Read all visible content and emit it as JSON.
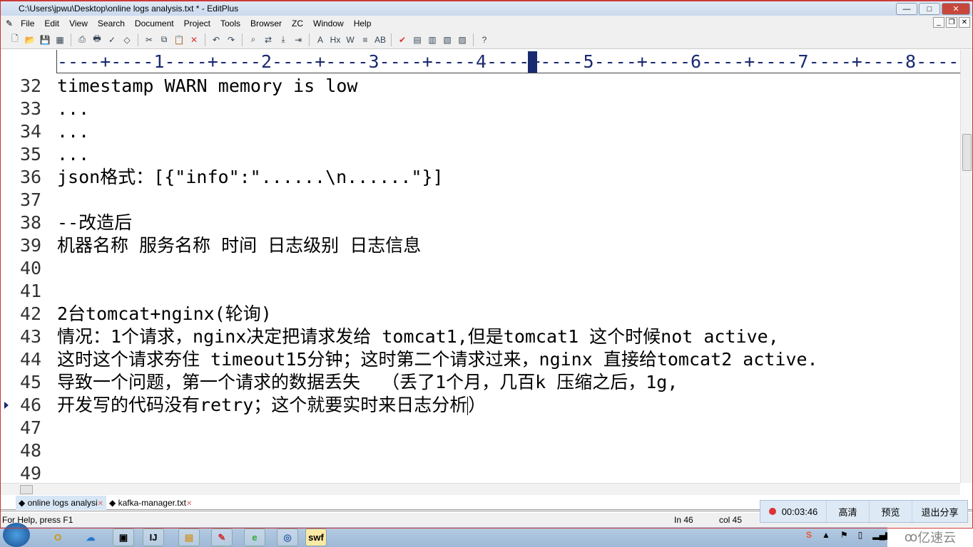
{
  "window": {
    "title": "C:\\Users\\jpwu\\Desktop\\online logs analysis.txt * - EditPlus",
    "minimize": "—",
    "maximize": "□",
    "close": "✕"
  },
  "menu": [
    "File",
    "Edit",
    "View",
    "Search",
    "Document",
    "Project",
    "Tools",
    "Browser",
    "ZC",
    "Window",
    "Help"
  ],
  "toolbar_icons": [
    "new-file",
    "open",
    "save",
    "save-all",
    "print-preview",
    "print",
    "spell-check",
    "browser-preview",
    "cut",
    "copy",
    "paste",
    "delete",
    "undo",
    "redo",
    "find",
    "replace",
    "goto",
    "indent",
    "font",
    "hex",
    "word-wrap",
    "line-numbers",
    "column-select",
    "check",
    "toggle-1",
    "toggle-2",
    "toggle-3",
    "toggle-4",
    "help"
  ],
  "ruler": {
    "text": "----+----1----+----2----+----3----+----4----+----5----+----6----+----7----+----8----",
    "cursor_col": 45
  },
  "editor": {
    "lines": [
      {
        "n": "32",
        "t": "timestamp WARN memory is low"
      },
      {
        "n": "33",
        "t": "..."
      },
      {
        "n": "34",
        "t": "..."
      },
      {
        "n": "35",
        "t": "..."
      },
      {
        "n": "36",
        "t": "json格式：[{\"info\":\"......\\n......\"}]"
      },
      {
        "n": "37",
        "t": ""
      },
      {
        "n": "38",
        "t": "--改造后"
      },
      {
        "n": "39",
        "t": "机器名称 服务名称 时间 日志级别 日志信息"
      },
      {
        "n": "40",
        "t": ""
      },
      {
        "n": "41",
        "t": ""
      },
      {
        "n": "42",
        "t": "2台tomcat+nginx(轮询)"
      },
      {
        "n": "43",
        "t": "情况：1个请求，nginx决定把请求发给 tomcat1,但是tomcat1 这个时候not active,"
      },
      {
        "n": "44",
        "t": "这时这个请求夯住 timeout15分钟；这时第二个请求过来，nginx 直接给tomcat2 active."
      },
      {
        "n": "45",
        "t": "导致一个问题，第一个请求的数据丢失  （丢了1个月，几百k 压缩之后，1g,"
      },
      {
        "n": "46",
        "t": "开发写的代码没有retry；这个就要实时来日志分析）"
      },
      {
        "n": "47",
        "t": ""
      },
      {
        "n": "48",
        "t": ""
      },
      {
        "n": "49",
        "t": ""
      }
    ],
    "current_line": "46"
  },
  "tabs": [
    {
      "label": "online logs analysi",
      "active": true
    },
    {
      "label": "kafka-manager.txt",
      "active": false
    }
  ],
  "status": {
    "help": "For Help, press F1",
    "line": "In 46",
    "col": "col 45"
  },
  "share_bar": {
    "timer": "00:03:46",
    "hd": "高清",
    "preview": "预览",
    "exit": "退出分享",
    "record_color": "#dd3333"
  },
  "taskbar": {
    "apps": [
      "outlook",
      "baidu-cloud",
      "window-manager",
      "intellij-idea",
      "file-explorer",
      "paint",
      "ie-browser",
      "chrome",
      "swf-player"
    ],
    "tray": [
      "sogou-ime",
      "show-hidden",
      "flag",
      "power",
      "network"
    ],
    "watermark": "亿速云"
  }
}
